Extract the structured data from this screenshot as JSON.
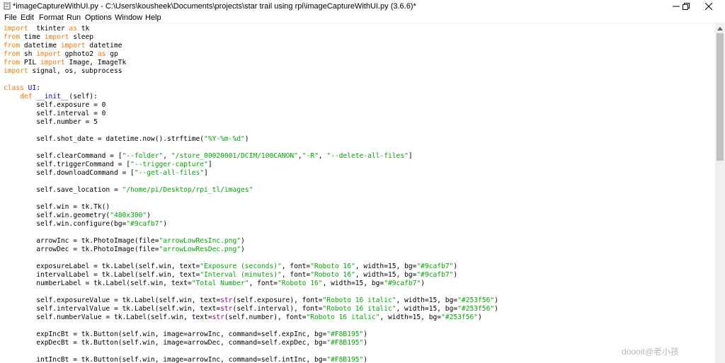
{
  "window": {
    "title": "*imageCaptureWithUI.py - C:\\Users\\kousheek\\Documents\\projects\\star trail using rpi\\imageCaptureWithUI.py (3.6.6)*",
    "controls": {
      "minimize_icon": "minimize-icon",
      "maximize_icon": "maximize-icon",
      "close_icon": "close-icon"
    }
  },
  "menu": [
    "File",
    "Edit",
    "Format",
    "Run",
    "Options",
    "Window",
    "Help"
  ],
  "code": [
    [
      [
        "kw",
        "import"
      ],
      [
        "",
        "  tkinter "
      ],
      [
        "kw",
        "as"
      ],
      [
        "",
        " tk"
      ]
    ],
    [
      [
        "kw",
        "from"
      ],
      [
        "",
        " time "
      ],
      [
        "kw",
        "import"
      ],
      [
        "",
        " sleep"
      ]
    ],
    [
      [
        "kw",
        "from"
      ],
      [
        "",
        " datetime "
      ],
      [
        "kw",
        "import"
      ],
      [
        "",
        " datetime"
      ]
    ],
    [
      [
        "kw",
        "from"
      ],
      [
        "",
        " sh "
      ],
      [
        "kw",
        "import"
      ],
      [
        "",
        " gphoto2 "
      ],
      [
        "kw",
        "as"
      ],
      [
        "",
        " gp"
      ]
    ],
    [
      [
        "kw",
        "from"
      ],
      [
        "",
        " PIL "
      ],
      [
        "kw",
        "import"
      ],
      [
        "",
        " Image, ImageTk"
      ]
    ],
    [
      [
        "kw",
        "import"
      ],
      [
        "",
        " signal, os, subprocess"
      ]
    ],
    [],
    [
      [
        "kw",
        "class"
      ],
      [
        "def",
        " UI"
      ],
      [
        "",
        ":"
      ]
    ],
    [
      [
        "",
        "    "
      ],
      [
        "kw",
        "def"
      ],
      [
        "def",
        " __init__"
      ],
      [
        "",
        "(self):"
      ]
    ],
    [
      [
        "",
        "        self.exposure = 0"
      ]
    ],
    [
      [
        "",
        "        self.interval = 0"
      ]
    ],
    [
      [
        "",
        "        self.number = 5"
      ]
    ],
    [],
    [
      [
        "",
        "        self.shot_date = datetime.now().strftime("
      ],
      [
        "str",
        "\"%Y-%m-%d\""
      ],
      [
        "",
        ")"
      ]
    ],
    [],
    [
      [
        "",
        "        self.clearCommand = ["
      ],
      [
        "str",
        "\"--folder\""
      ],
      [
        "",
        ", "
      ],
      [
        "str",
        "\"/store_00020001/DCIM/100CANON\""
      ],
      [
        "",
        ","
      ],
      [
        "str",
        "\"-R\""
      ],
      [
        "",
        ", "
      ],
      [
        "str",
        "\"--delete-all-files\""
      ],
      [
        "",
        "]"
      ]
    ],
    [
      [
        "",
        "        self.triggerCommand = ["
      ],
      [
        "str",
        "\"--trigger-capture\""
      ],
      [
        "",
        "]"
      ]
    ],
    [
      [
        "",
        "        self.downloadCommand = ["
      ],
      [
        "str",
        "\"--get-all-files\""
      ],
      [
        "",
        "]"
      ]
    ],
    [],
    [
      [
        "",
        "        self.save_location = "
      ],
      [
        "str",
        "\"/home/pi/Desktop/rpi_tl/images\""
      ]
    ],
    [],
    [
      [
        "",
        "        self.win = tk.Tk()"
      ]
    ],
    [
      [
        "",
        "        self.win.geometry("
      ],
      [
        "str",
        "\"480x300\""
      ],
      [
        "",
        ")"
      ]
    ],
    [
      [
        "",
        "        self.win.configure(bg="
      ],
      [
        "str",
        "\"#9cafb7\""
      ],
      [
        "",
        ")"
      ]
    ],
    [],
    [
      [
        "",
        "        arrowInc = tk.PhotoImage(file="
      ],
      [
        "str",
        "\"arrowLowResInc.png\""
      ],
      [
        "",
        ")"
      ]
    ],
    [
      [
        "",
        "        arrowDec = tk.PhotoImage(file="
      ],
      [
        "str",
        "\"arrowLowResDec.png\""
      ],
      [
        "",
        ")"
      ]
    ],
    [],
    [
      [
        "",
        "        exposureLabel = tk.Label(self.win, text="
      ],
      [
        "str",
        "\"Exposure (seconds)\""
      ],
      [
        "",
        ", font="
      ],
      [
        "str",
        "\"Roboto 16\""
      ],
      [
        "",
        ", width=15, bg="
      ],
      [
        "str",
        "\"#9cafb7\""
      ],
      [
        "",
        ")"
      ]
    ],
    [
      [
        "",
        "        intervalLabel = tk.Label(self.win, text="
      ],
      [
        "str",
        "\"Interval (minutes)\""
      ],
      [
        "",
        ", font="
      ],
      [
        "str",
        "\"Roboto 16\""
      ],
      [
        "",
        ", width=15, bg="
      ],
      [
        "str",
        "\"#9cafb7\""
      ],
      [
        "",
        ")"
      ]
    ],
    [
      [
        "",
        "        numberLabel = tk.Label(self.win, text="
      ],
      [
        "str",
        "\"Total Number\""
      ],
      [
        "",
        ", font="
      ],
      [
        "str",
        "\"Roboto 16\""
      ],
      [
        "",
        ", width=15, bg="
      ],
      [
        "str",
        "\"#9cafb7\""
      ],
      [
        "",
        ")"
      ]
    ],
    [],
    [
      [
        "",
        "        self.exposureValue = tk.Label(self.win, text="
      ],
      [
        "bi",
        "str"
      ],
      [
        "",
        "(self.exposure), font="
      ],
      [
        "str",
        "\"Roboto 16 italic\""
      ],
      [
        "",
        ", width=15, bg="
      ],
      [
        "str",
        "\"#253f56\""
      ],
      [
        "",
        ")"
      ]
    ],
    [
      [
        "",
        "        self.intervalValue = tk.Label(self.win, text="
      ],
      [
        "bi",
        "str"
      ],
      [
        "",
        "(self.interval), font="
      ],
      [
        "str",
        "\"Roboto 16 italic\""
      ],
      [
        "",
        ", width=15, bg="
      ],
      [
        "str",
        "\"#253f56\""
      ],
      [
        "",
        ")"
      ]
    ],
    [
      [
        "",
        "        self.numberValue = tk.Label(self.win, text="
      ],
      [
        "bi",
        "str"
      ],
      [
        "",
        "(self.number), font="
      ],
      [
        "str",
        "\"Roboto 16 italic\""
      ],
      [
        "",
        ", width=15, bg="
      ],
      [
        "str",
        "\"#253f56\""
      ],
      [
        "",
        ")"
      ]
    ],
    [],
    [
      [
        "",
        "        expIncBt = tk.Button(self.win, image=arrowInc, command=self.expInc, bg="
      ],
      [
        "str",
        "\"#F8B195\""
      ],
      [
        "",
        ")"
      ]
    ],
    [
      [
        "",
        "        expDecBt = tk.Button(self.win, image=arrowDec, command=self.expDec, bg="
      ],
      [
        "str",
        "\"#F8B195\""
      ],
      [
        "",
        ")"
      ]
    ],
    [],
    [
      [
        "",
        "        intIncBt = tk.Button(self.win, image=arrowInc, command=self.intInc, bg="
      ],
      [
        "str",
        "\"#F8B195\""
      ],
      [
        "",
        ")"
      ]
    ]
  ],
  "watermark": "doooit@老小孩",
  "colors": {
    "keyword": "#ff7700",
    "string": "#00aa00",
    "builtin": "#900090",
    "definition": "#0000ff",
    "text": "#000000",
    "background": "#ffffff"
  }
}
